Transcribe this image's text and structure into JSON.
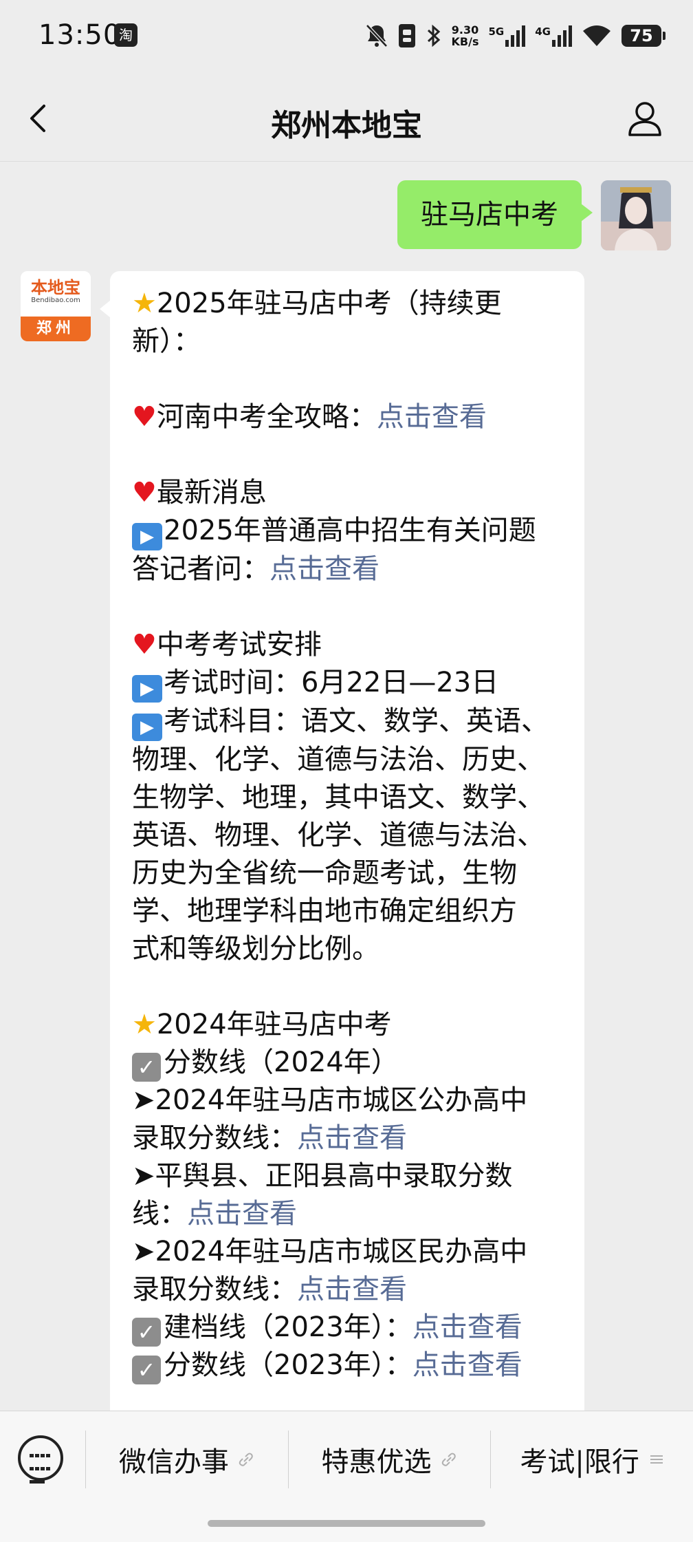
{
  "status_bar": {
    "time": "13:50",
    "app_icon_label": "淘",
    "net_speed_value": "9.30",
    "net_speed_unit": "KB/s",
    "sig1_label": "5G",
    "sig2_label": "4G",
    "battery": "75"
  },
  "nav": {
    "title": "郑州本地宝"
  },
  "sent_message": {
    "text": "驻马店中考"
  },
  "bot_avatar": {
    "cn": "本地宝",
    "en": "Bendibao.com",
    "city": "郑州"
  },
  "message": {
    "l1": "2025年驻马店中考（持续更",
    "l2": "新）：",
    "l3_text": "河南中考全攻略：",
    "l3_link": "点击查看",
    "l4": "最新消息",
    "l5": "2025年普通高中招生有关问题",
    "l6_text": "答记者问：",
    "l6_link": "点击查看",
    "l7": "中考考试安排",
    "l8": "考试时间：6月22日—23日",
    "l9": "考试科目：语文、数学、英语、",
    "l10": "物理、化学、道德与法治、历史、",
    "l11": "生物学、地理，其中语文、数学、",
    "l12": "英语、物理、化学、道德与法治、",
    "l13": "历史为全省统一命题考试，生物",
    "l14": "学、地理学科由地市确定组织方",
    "l15": "式和等级划分比例。",
    "l16": "2024年驻马店中考",
    "l17": "分数线（2024年）",
    "l18": "➤2024年驻马店市城区公办高中",
    "l19_text": "录取分数线：",
    "l19_link": "点击查看",
    "l20": "➤平舆县、正阳县高中录取分数",
    "l21_text": "线：",
    "l21_link": "点击查看",
    "l22": "➤2024年驻马店市城区民办高中",
    "l23_text": "录取分数线：",
    "l23_link": "点击查看",
    "l24_text": "建档线（2023年）：",
    "l24_link": "点击查看",
    "l25_text": "分数线（2023年）：",
    "l25_link": "点击查看"
  },
  "menu": {
    "item1": "微信办事",
    "item2": "特惠优选",
    "item3": "考试|限行"
  }
}
